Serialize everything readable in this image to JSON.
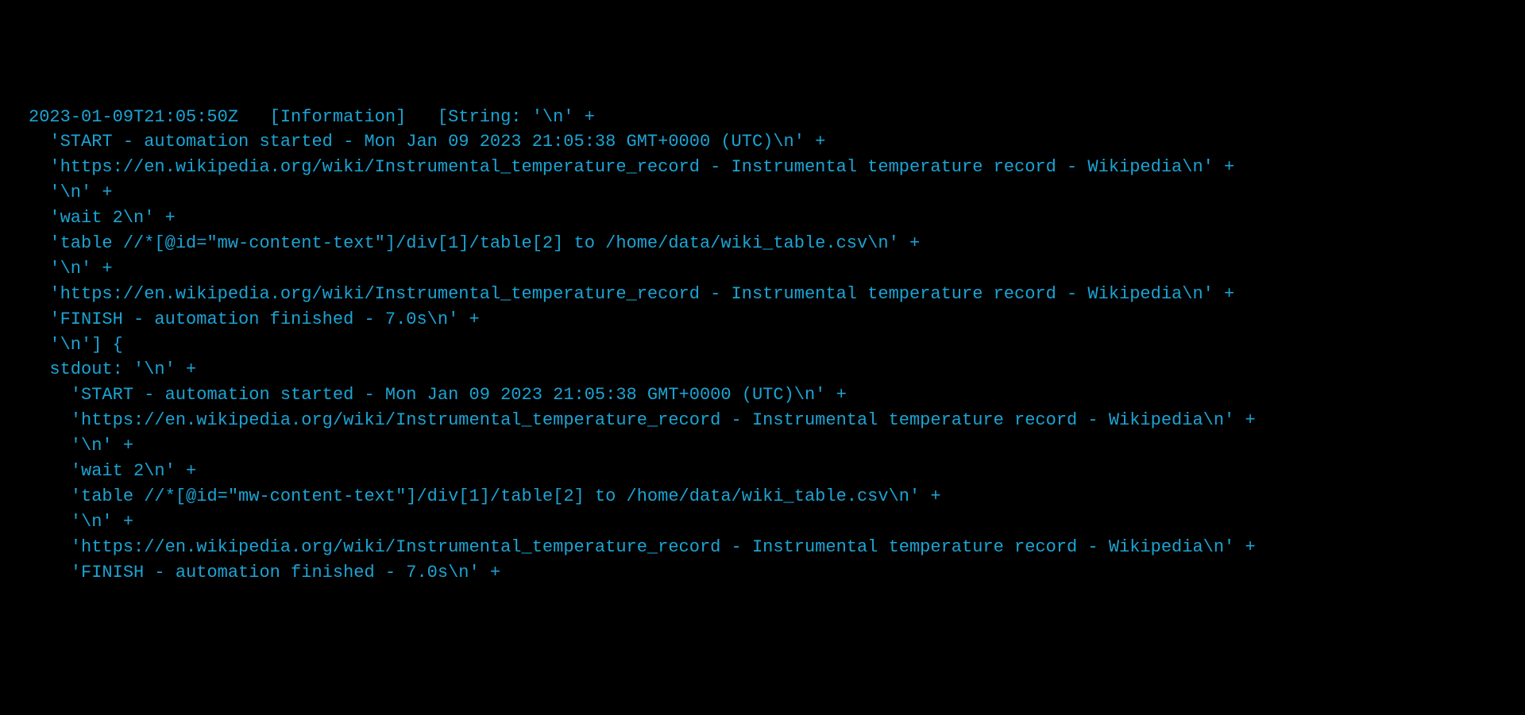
{
  "terminal": {
    "lines": [
      "2023-01-09T21:05:50Z   [Information]   [String: '\\n' +",
      "  'START - automation started - Mon Jan 09 2023 21:05:38 GMT+0000 (UTC)\\n' +",
      "  'https://en.wikipedia.org/wiki/Instrumental_temperature_record - Instrumental temperature record - Wikipedia\\n' +",
      "  '\\n' +",
      "  'wait 2\\n' +",
      "  'table //*[@id=\"mw-content-text\"]/div[1]/table[2] to /home/data/wiki_table.csv\\n' +",
      "  '\\n' +",
      "  'https://en.wikipedia.org/wiki/Instrumental_temperature_record - Instrumental temperature record - Wikipedia\\n' +",
      "  'FINISH - automation finished - 7.0s\\n' +",
      "  '\\n'] {",
      "  stdout: '\\n' +",
      "    'START - automation started - Mon Jan 09 2023 21:05:38 GMT+0000 (UTC)\\n' +",
      "    'https://en.wikipedia.org/wiki/Instrumental_temperature_record - Instrumental temperature record - Wikipedia\\n' +",
      "    '\\n' +",
      "    'wait 2\\n' +",
      "    'table //*[@id=\"mw-content-text\"]/div[1]/table[2] to /home/data/wiki_table.csv\\n' +",
      "    '\\n' +",
      "    'https://en.wikipedia.org/wiki/Instrumental_temperature_record - Instrumental temperature record - Wikipedia\\n' +",
      "    'FINISH - automation finished - 7.0s\\n' +"
    ]
  }
}
